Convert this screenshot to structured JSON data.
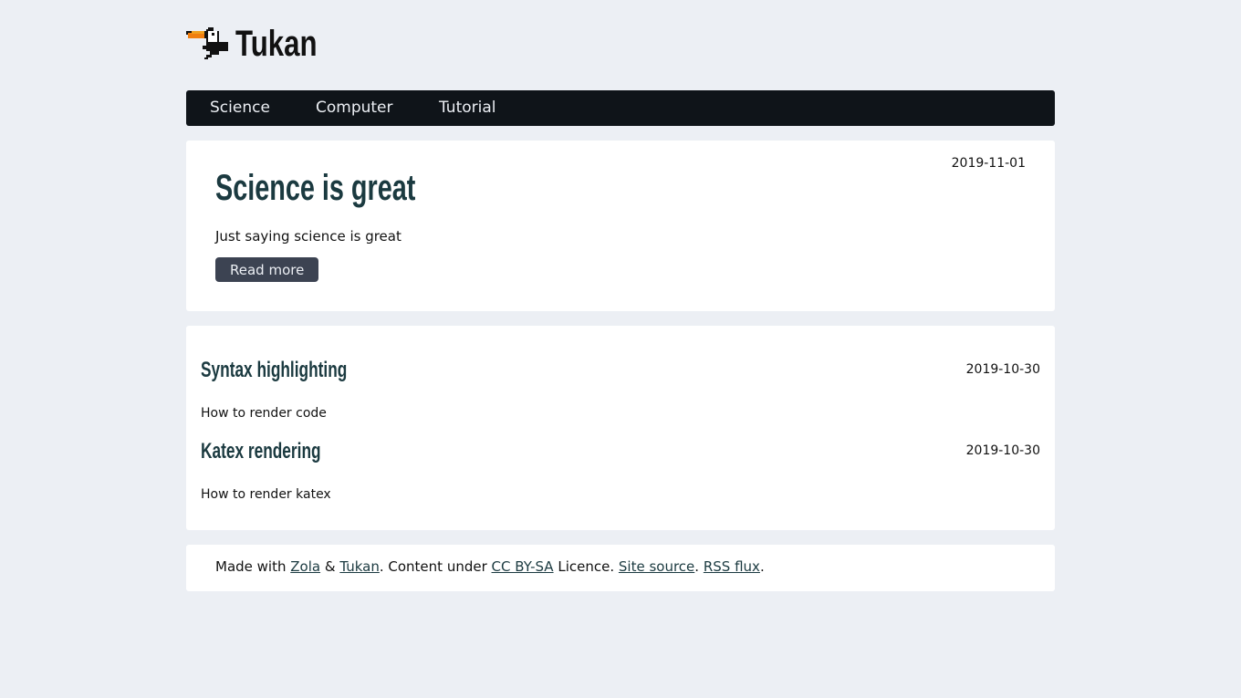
{
  "site": {
    "title": "Tukan"
  },
  "nav": {
    "items": [
      {
        "label": "Science"
      },
      {
        "label": "Computer"
      },
      {
        "label": "Tutorial"
      }
    ]
  },
  "featured": {
    "title": "Science is great",
    "date": "2019-11-01",
    "summary": "Just saying science is great",
    "read_more": "Read more"
  },
  "posts": [
    {
      "title": "Syntax highlighting",
      "date": "2019-10-30",
      "summary": "How to render code"
    },
    {
      "title": "Katex rendering",
      "date": "2019-10-30",
      "summary": "How to render katex"
    }
  ],
  "footer": {
    "made_with": "Made with",
    "zola": "Zola",
    "amp": "&",
    "tukan": "Tukan",
    "content_under": ". Content under",
    "license_link": "CC BY-SA",
    "licence": "Licence.",
    "site_source": "Site source",
    "dot1": ".",
    "rss": "RSS flux",
    "dot2": "."
  },
  "colors": {
    "background": "#eceff4",
    "nav": "#0f1419",
    "title": "#1b3a40",
    "button": "#3c4352"
  }
}
